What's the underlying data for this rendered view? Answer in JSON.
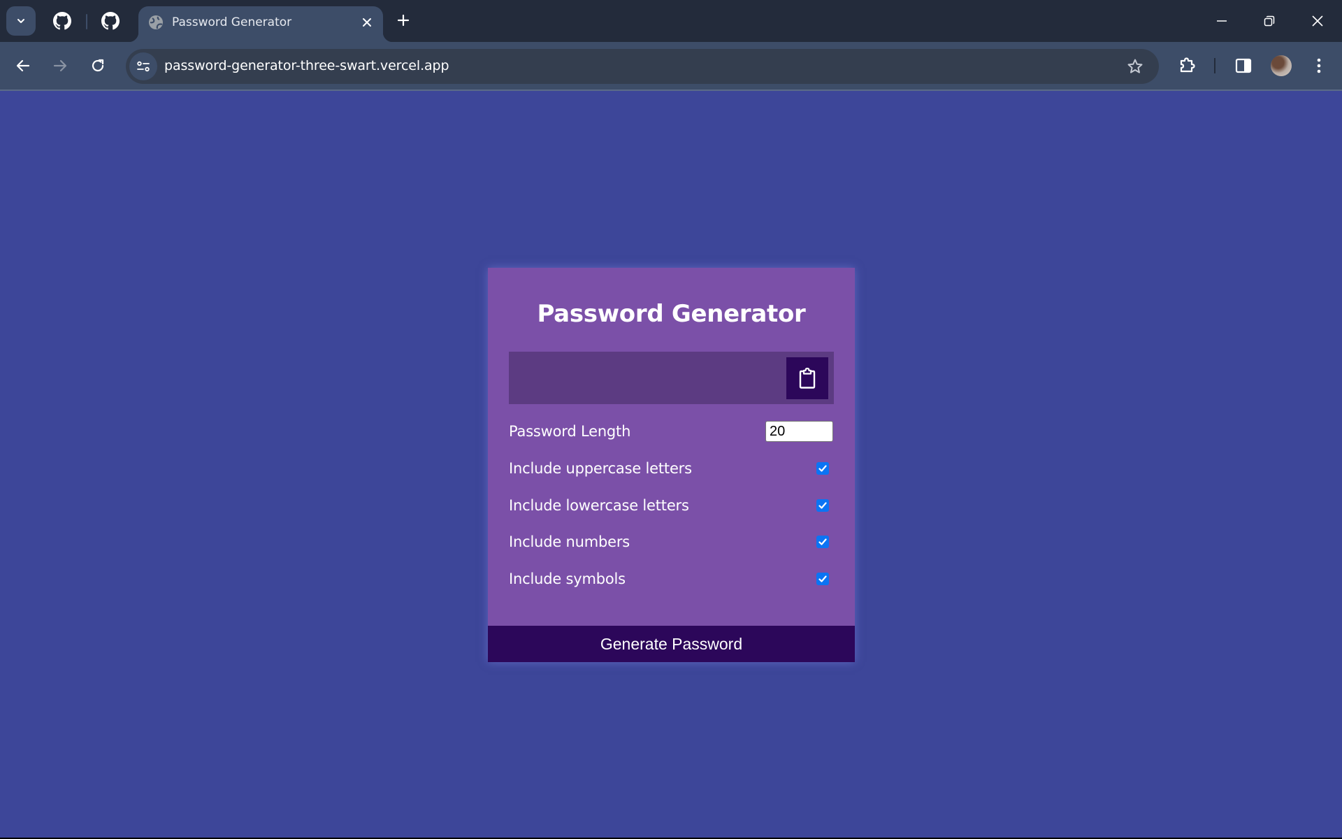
{
  "browser": {
    "tab": {
      "title": "Password Generator",
      "favicon": "globe-icon"
    },
    "pinned_tabs": [
      {
        "icon": "github-icon"
      },
      {
        "icon": "github-icon"
      }
    ],
    "url": "password-generator-three-swart.vercel.app",
    "icons": {
      "tab_search": "chevron-down-icon",
      "new_tab": "plus-icon",
      "back": "arrow-left-icon",
      "forward": "arrow-right-icon",
      "reload": "reload-icon",
      "site_info": "tune-icon",
      "bookmark": "star-icon",
      "extensions": "puzzle-icon",
      "side_panel": "side-panel-icon",
      "menu": "more-vertical-icon",
      "minimize": "minimize-icon",
      "restore": "restore-icon",
      "close": "close-icon"
    }
  },
  "app": {
    "title": "Password Generator",
    "result": {
      "value": "",
      "copy_icon": "clipboard-icon"
    },
    "length": {
      "label": "Password Length",
      "value": "20"
    },
    "options": [
      {
        "label": "Include uppercase letters",
        "checked": true
      },
      {
        "label": "Include lowercase letters",
        "checked": true
      },
      {
        "label": "Include numbers",
        "checked": true
      },
      {
        "label": "Include symbols",
        "checked": true
      }
    ],
    "generate_label": "Generate Password",
    "colors": {
      "page_bg": "#3d4699",
      "card_bg": "#7b50a8",
      "result_bg": "#5c3b82",
      "button_bg": "#2c075a",
      "checkbox": "#0b74f4"
    }
  }
}
